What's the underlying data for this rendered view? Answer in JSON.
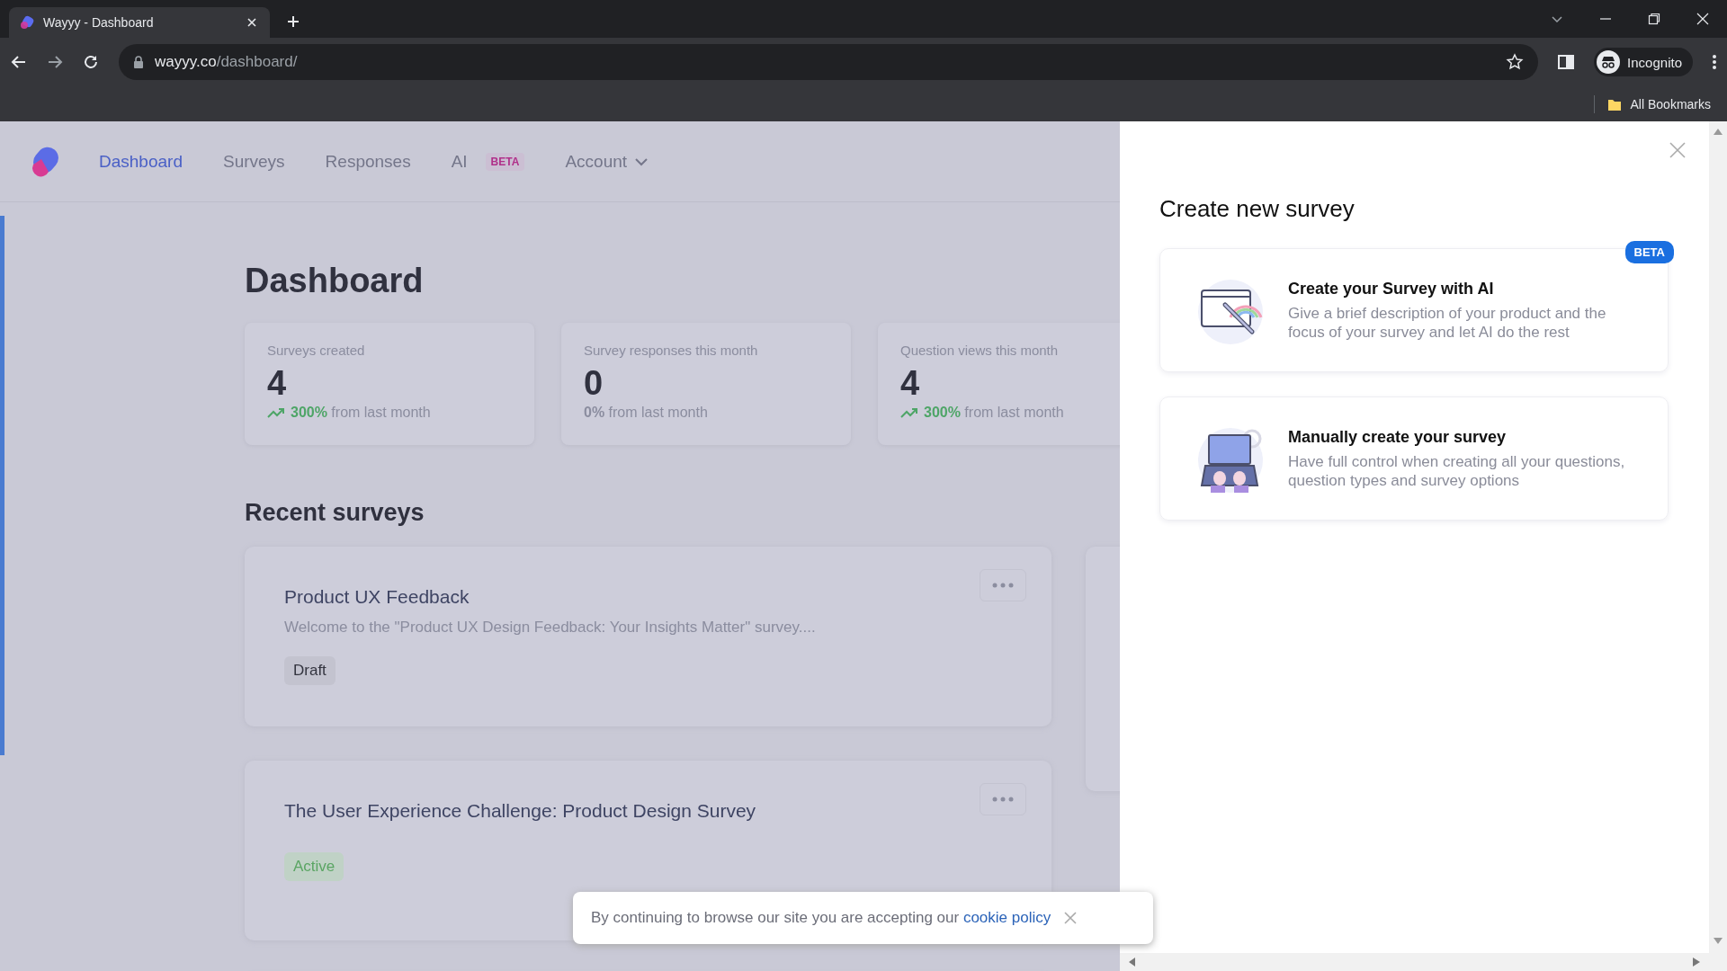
{
  "browser": {
    "tab_title": "Wayyy - Dashboard",
    "url_domain": "wayyy.co",
    "url_path": "/dashboard/",
    "profile": "Incognito",
    "bookmarks": "All Bookmarks"
  },
  "nav": {
    "items": [
      {
        "label": "Dashboard",
        "selected": true,
        "kind": "link"
      },
      {
        "label": "Surveys",
        "selected": false,
        "kind": "link"
      },
      {
        "label": "Responses",
        "selected": false,
        "kind": "link"
      },
      {
        "label": "AI",
        "selected": false,
        "kind": "link",
        "badge": "BETA"
      },
      {
        "label": "Account",
        "selected": false,
        "kind": "dropdown"
      }
    ]
  },
  "dashboard": {
    "title": "Dashboard",
    "stats": [
      {
        "label": "Surveys created",
        "value": "4",
        "change": "300%",
        "change_text": "from last month",
        "trend_up": true
      },
      {
        "label": "Survey responses this month",
        "value": "0",
        "change": "0%",
        "change_text": "from last month",
        "trend_up": false
      },
      {
        "label": "Question views this month",
        "value": "4",
        "change": "300%",
        "change_text": "from last month",
        "trend_up": true
      }
    ],
    "recent_title": "Recent surveys",
    "surveys": [
      {
        "title": "Product UX Feedback",
        "description": "Welcome to the \"Product UX Design Feedback: Your Insights Matter\" survey....",
        "status": "Draft",
        "kind": "draft"
      },
      {
        "title": "The User Experience Challenge: Product Design Survey",
        "status": "Active",
        "kind": "active"
      }
    ]
  },
  "drawer": {
    "title": "Create new survey",
    "options": [
      {
        "kind": "ai",
        "title": "Create your Survey with AI",
        "description": "Give a brief description of your product and the focus of your survey and let AI do the rest",
        "badge": "BETA"
      },
      {
        "kind": "manual",
        "title": "Manually create your survey",
        "description": "Have full control when creating all your questions, question types and survey options"
      }
    ]
  },
  "cookie": {
    "text": "By continuing to browse our site you are accepting our",
    "link": "cookie policy"
  }
}
